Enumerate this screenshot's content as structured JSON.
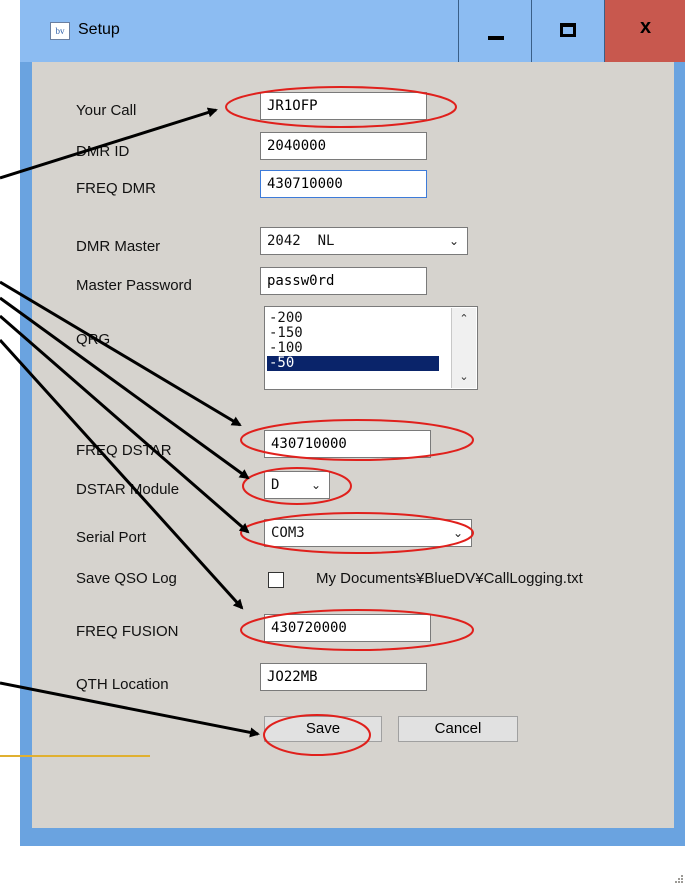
{
  "window": {
    "title": "Setup",
    "icon_text": "bv",
    "close_glyph": "x"
  },
  "form": {
    "your_call": {
      "label": "Your Call",
      "value": "JR1OFP"
    },
    "dmr_id": {
      "label": "DMR ID",
      "value": "2040000"
    },
    "freq_dmr": {
      "label": "FREQ DMR",
      "value": "430710000"
    },
    "dmr_master": {
      "label": "DMR Master",
      "value": "2042  NL"
    },
    "master_password": {
      "label": "Master Password",
      "value": "passw0rd"
    },
    "qrg": {
      "label": "QRG",
      "options": [
        "-200",
        "-150",
        "-100",
        "-50"
      ],
      "selected": "-50"
    },
    "freq_dstar": {
      "label": "FREQ DSTAR",
      "value": "430710000"
    },
    "dstar_module": {
      "label": "DSTAR Module",
      "value": "D"
    },
    "serial_port": {
      "label": "Serial Port",
      "value": "COM3"
    },
    "save_qso_log": {
      "label": "Save QSO Log",
      "checked": false,
      "path": "My Documents¥BlueDV¥CallLogging.txt"
    },
    "freq_fusion": {
      "label": "FREQ FUSION",
      "value": "430720000"
    },
    "qth_location": {
      "label": "QTH Location",
      "value": "JO22MB"
    }
  },
  "buttons": {
    "save": "Save",
    "cancel": "Cancel"
  },
  "icons": {
    "minimize": "minimize-icon",
    "maximize": "maximize-icon",
    "close": "close-icon",
    "dropdown": "chevron-down-icon",
    "scroll_up": "chevron-up-icon"
  },
  "colors": {
    "titlebar": "#8cbcf2",
    "close_button": "#c8584e",
    "dialog_bg": "#d6d3ce",
    "selection": "#0a246a",
    "annotation_arrow": "#000000",
    "annotation_ellipse": "#e0201c"
  }
}
